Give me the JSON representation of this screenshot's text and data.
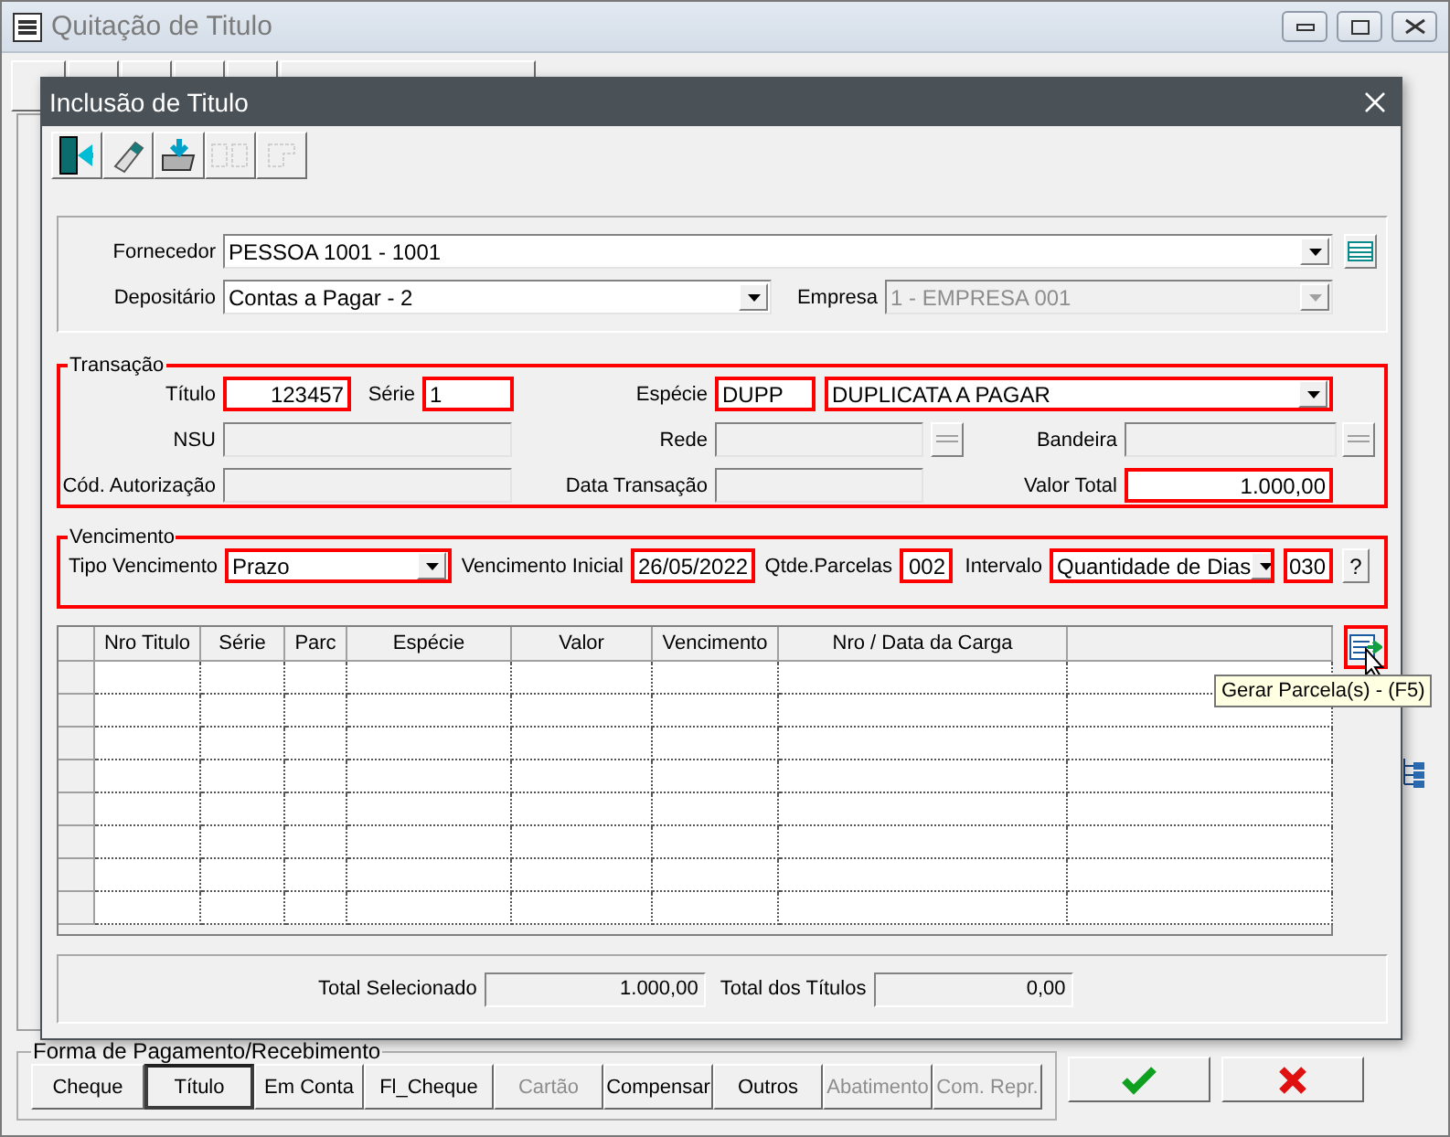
{
  "main_window": {
    "title": "Quitação de Titulo",
    "payment_group": {
      "legend": "Forma de Pagamento/Recebimento",
      "buttons": [
        {
          "label": "Cheque",
          "selected": false,
          "disabled": false
        },
        {
          "label": "Título",
          "selected": true,
          "disabled": false
        },
        {
          "label": "Em Conta",
          "selected": false,
          "disabled": false
        },
        {
          "label": "Fl_Cheque",
          "selected": false,
          "disabled": false
        },
        {
          "label": "Cartão",
          "selected": false,
          "disabled": true
        },
        {
          "label": "Compensar",
          "selected": false,
          "disabled": false
        },
        {
          "label": "Outros",
          "selected": false,
          "disabled": false
        },
        {
          "label": "Abatimento",
          "selected": false,
          "disabled": true
        },
        {
          "label": "Com. Repr.",
          "selected": false,
          "disabled": true
        }
      ]
    }
  },
  "dialog": {
    "title": "Inclusão de Titulo",
    "toolbar": [
      {
        "kind": "exit",
        "disabled": false
      },
      {
        "kind": "eraser",
        "disabled": false
      },
      {
        "kind": "import",
        "disabled": false
      },
      {
        "kind": "split",
        "disabled": true
      },
      {
        "kind": "merge",
        "disabled": true
      }
    ],
    "header": {
      "fornecedor": {
        "label": "Fornecedor",
        "value": "PESSOA 1001 - 1001",
        "disabled": false
      },
      "depositario": {
        "label": "Depositário",
        "value": "Contas a Pagar - 2",
        "disabled": false
      },
      "empresa": {
        "label": "Empresa",
        "value": "1 - EMPRESA 001",
        "disabled": true
      }
    },
    "transacao": {
      "legend": "Transação",
      "highlighted": true,
      "titulo": {
        "label": "Título",
        "value": "123457",
        "required": true,
        "disabled": false
      },
      "serie": {
        "label": "Série",
        "value": "1",
        "required": true,
        "disabled": false
      },
      "especie": {
        "label": "Espécie",
        "code": "DUPP",
        "value": "DUPLICATA A PAGAR",
        "required": true,
        "disabled": false
      },
      "nsu": {
        "label": "NSU",
        "required": false,
        "disabled": true
      },
      "rede": {
        "label": "Rede",
        "required": false,
        "disabled": true
      },
      "bandeira": {
        "label": "Bandeira",
        "required": false,
        "disabled": true
      },
      "autorizacao": {
        "label": "Cód. Autorização",
        "required": false,
        "disabled": true
      },
      "data_transacao": {
        "label": "Data Transação",
        "required": false,
        "disabled": true
      },
      "valor_total": {
        "label": "Valor Total",
        "value": "1.000,00",
        "required": true,
        "disabled": false
      }
    },
    "vencimento": {
      "legend": "Vencimento",
      "highlighted": true,
      "tipo": {
        "label": "Tipo Vencimento",
        "value": "Prazo",
        "required": true
      },
      "inicial": {
        "label": "Vencimento Inicial",
        "value": "26/05/2022",
        "required": true
      },
      "parcelas": {
        "label": "Qtde.Parcelas",
        "value": "002",
        "required": true
      },
      "intervalo": {
        "label": "Intervalo",
        "value": "Quantidade de Dias",
        "required": true
      },
      "dias": {
        "value": "030",
        "required": true
      },
      "help": "?"
    },
    "grid": {
      "columns": [
        "Nro Titulo",
        "Série",
        "Parc",
        "Espécie",
        "Valor",
        "Vencimento",
        "Nro / Data da Carga"
      ]
    },
    "generate_button": {
      "highlighted": true,
      "tooltip": "Gerar Parcela(s) - (F5)"
    },
    "totals": {
      "selecionado": {
        "label": "Total Selecionado",
        "value": "1.000,00"
      },
      "titulos": {
        "label": "Total dos Títulos",
        "value": "0,00"
      }
    }
  }
}
